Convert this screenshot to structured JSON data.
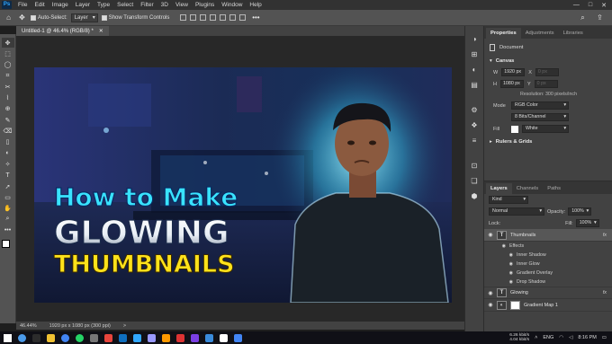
{
  "app": {
    "logo": "Ps"
  },
  "menu": [
    "File",
    "Edit",
    "Image",
    "Layer",
    "Type",
    "Select",
    "Filter",
    "3D",
    "View",
    "Plugins",
    "Window",
    "Help"
  ],
  "window_controls": {
    "minimize": "—",
    "maximize": "□",
    "close": "✕"
  },
  "options_bar": {
    "home_glyph": "⌂",
    "move_glyph": "✥",
    "auto_select_label": "Auto-Select:",
    "auto_select_value": "Layer",
    "transform_label": "Show Transform Controls",
    "dots_glyph": "•••",
    "search_glyph": "⌕",
    "share_glyph": "⇪"
  },
  "tools": [
    "✥",
    "⬚",
    "◯",
    "⌗",
    "✂",
    "⌇",
    "⊕",
    "✎",
    "⌫",
    "▯",
    "◐",
    "✧",
    "T",
    "➚",
    "▭",
    "✋",
    "⌕",
    "•••"
  ],
  "document": {
    "tab_label": "Untitled-1 @ 46.4% (RGB/8) *",
    "close_glyph": "✕"
  },
  "artwork": {
    "line1": "How to Make",
    "line2": "GLOWING",
    "line3": "THUMBNAILS",
    "accent_cyan": "#39e3ff",
    "accent_yellow": "#ffe21a"
  },
  "status_bar": {
    "zoom": "46.44%",
    "doc_info": "1920 px x 1080 px (300 ppi)",
    "arrow": ">"
  },
  "right_icons": [
    "◑",
    "⊞",
    "◐",
    "▤",
    "⚙",
    "❖",
    "≡",
    "⊡",
    "❏",
    "⬢"
  ],
  "properties": {
    "tabs": [
      "Properties",
      "Adjustments",
      "Libraries"
    ],
    "doc_label": "Document",
    "canvas_section": "Canvas",
    "w_label": "W",
    "w_value": "1920 px",
    "x_label": "X",
    "x_value": "0 px",
    "h_label": "H",
    "h_value": "1080 px",
    "y_label": "Y",
    "y_value": "0 px",
    "resolution_text": "Resolution: 300 pixels/inch",
    "mode_label": "Mode",
    "mode_value": "RGB Color",
    "depth_value": "8 Bits/Channel",
    "fill_label": "Fill",
    "fill_value": "White",
    "rulers_section": "Rulers & Grids"
  },
  "layers_panel": {
    "tabs": [
      "Layers",
      "Channels",
      "Paths"
    ],
    "kind_value": "Kind",
    "blend_mode": "Normal",
    "opacity_label": "Opacity:",
    "opacity_value": "100%",
    "lock_label": "Lock:",
    "fill_label": "Fill:",
    "fill_value": "100%",
    "layers": [
      {
        "name": "Thumbnails",
        "thumb": "T",
        "fx": "fx",
        "selected": true
      },
      {
        "name": "Glowing",
        "thumb": "T",
        "fx": "fx",
        "selected": false
      },
      {
        "name": "Gradient Map 1",
        "thumb": "",
        "fx": "",
        "selected": false
      }
    ],
    "effects_label": "Effects",
    "effects": [
      "Inner Shadow",
      "Inner Glow",
      "Gradient Overlay",
      "Drop Shadow"
    ]
  },
  "taskbar": {
    "icon_colors": [
      "#ffffff",
      "#4b9bea",
      "#2c2c2c",
      "#f1c232",
      "#4285f4",
      "#25d366",
      "#777777",
      "#e8453c",
      "#0f6fbf",
      "#31a8ff",
      "#9999ff",
      "#ff9a00",
      "#d33",
      "#7b3fe4",
      "#3a8bdb",
      "#ffffff",
      "#4285f4"
    ],
    "up_speed": "6.26 kbit/s",
    "down_speed": "4.04 kbit/s",
    "language": "ENG",
    "time": "8:16 PM"
  }
}
